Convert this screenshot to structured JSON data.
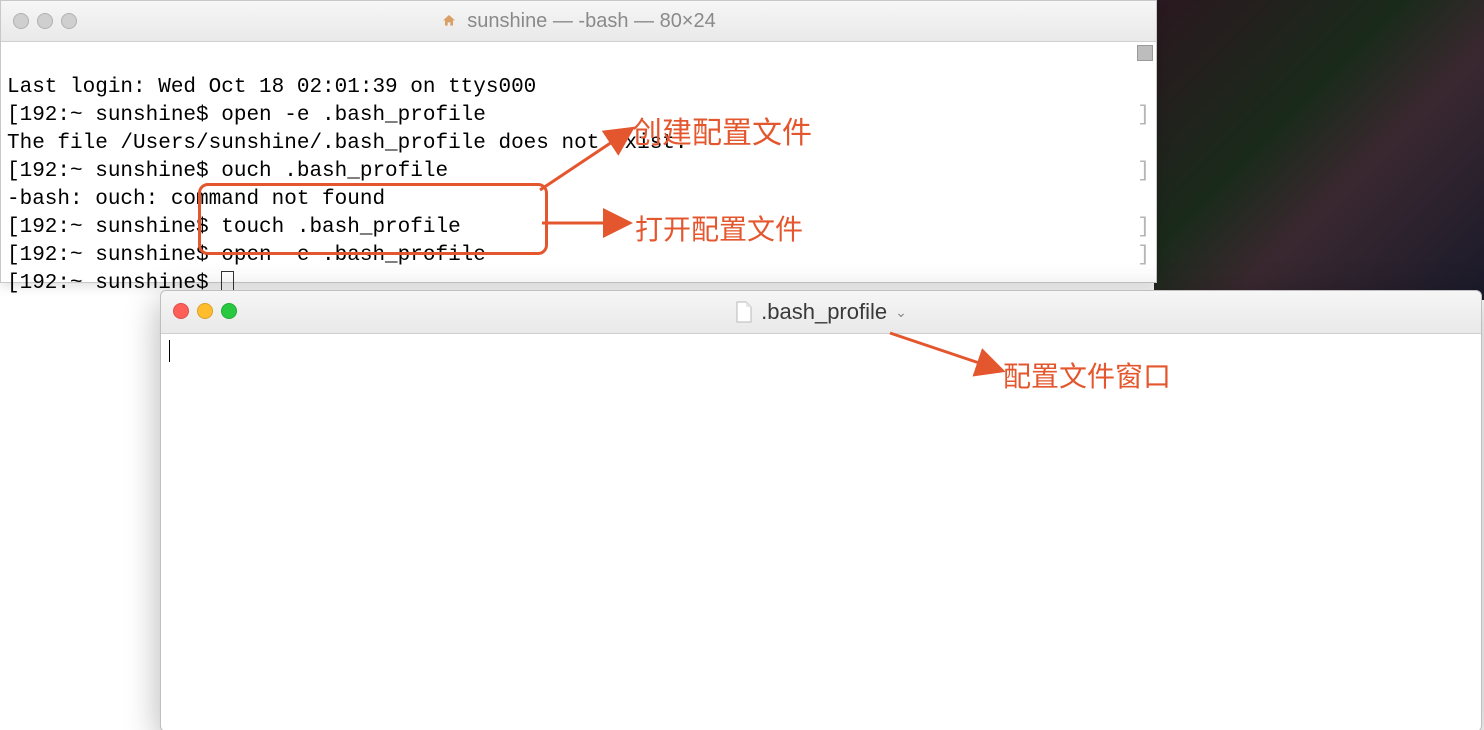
{
  "terminal": {
    "title": "sunshine — -bash — 80×24",
    "lines": [
      "Last login: Wed Oct 18 02:01:39 on ttys000",
      "[192:~ sunshine$ open -e .bash_profile",
      "The file /Users/sunshine/.bash_profile does not exist.",
      "[192:~ sunshine$ ouch .bash_profile",
      "-bash: ouch: command not found",
      "[192:~ sunshine$ touch .bash_profile",
      "[192:~ sunshine$ open -e .bash_profile",
      "[192:~ sunshine$ "
    ]
  },
  "editor": {
    "title": ".bash_profile"
  },
  "annotations": {
    "create": "创建配置文件",
    "open": "打开配置文件",
    "window": "配置文件窗口"
  }
}
